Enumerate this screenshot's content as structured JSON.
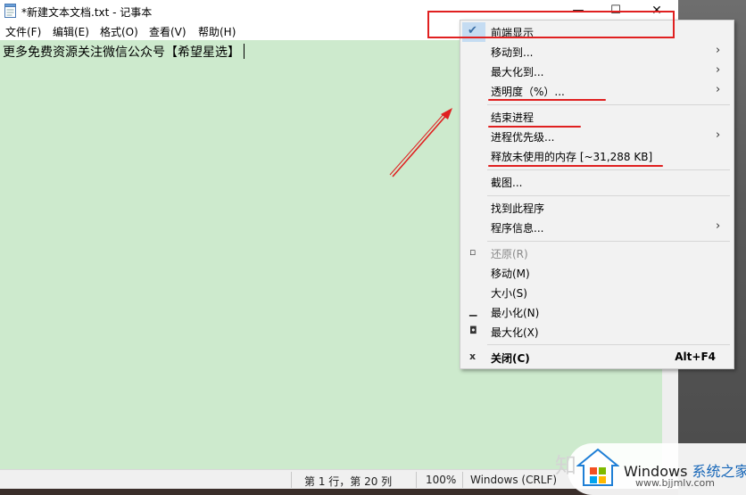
{
  "window": {
    "title": "*新建文本文档.txt - 记事本",
    "minimize_glyph": "—",
    "maximize_glyph": "☐",
    "close_glyph": "✕"
  },
  "menubar": {
    "items": [
      "文件(F)",
      "编辑(E)",
      "格式(O)",
      "查看(V)",
      "帮助(H)"
    ]
  },
  "editor": {
    "content": "更多免费资源关注微信公众号【希望星选】"
  },
  "statusbar": {
    "position": "第 1 行，第 20 列",
    "zoom": "100%",
    "line_ending": "Windows (CRLF)"
  },
  "context_menu": {
    "items": [
      {
        "label": "前端显示",
        "checked": true
      },
      {
        "label": "移动到...",
        "submenu": true
      },
      {
        "label": "最大化到...",
        "submenu": true
      },
      {
        "label": "透明度（%）...",
        "submenu": true
      },
      {
        "label": "结束进程"
      },
      {
        "label": "进程优先级...",
        "submenu": true
      },
      {
        "label": "释放未使用的内存 [~31,288 KB]"
      },
      {
        "label": "截图..."
      },
      {
        "label": "找到此程序"
      },
      {
        "label": "程序信息...",
        "submenu": true
      },
      {
        "label": "还原(R)",
        "disabled": true,
        "icon": "restore-icon"
      },
      {
        "label": "移动(M)"
      },
      {
        "label": "大小(S)"
      },
      {
        "label": "最小化(N)",
        "icon": "minimize-icon"
      },
      {
        "label": "最大化(X)",
        "icon": "maximize-icon"
      },
      {
        "label": "关闭(C)",
        "bold": true,
        "icon": "close-icon",
        "shortcut": "Alt+F4"
      }
    ],
    "submenu_glyph": "›",
    "check_glyph": "✔"
  },
  "watermark": {
    "zhi": "知",
    "brand": "Windows",
    "brand_cn": "系统之家",
    "url": "www.bjjmlv.com"
  },
  "colors": {
    "editor_bg": "#cdeacd",
    "annotation": "#e02020",
    "checked_bg": "#c5dcf2"
  }
}
